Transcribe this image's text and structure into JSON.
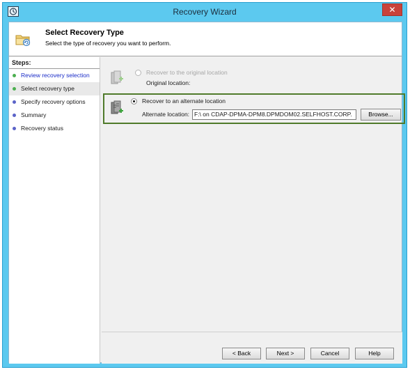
{
  "window": {
    "title": "Recovery Wizard",
    "close_label": "✕"
  },
  "header": {
    "title": "Select Recovery Type",
    "subtitle": "Select the type of recovery you want to perform."
  },
  "steps": {
    "heading": "Steps:",
    "items": [
      {
        "label": "Review recovery selection",
        "state": "done"
      },
      {
        "label": "Select recovery type",
        "state": "current"
      },
      {
        "label": "Specify recovery options",
        "state": "pending"
      },
      {
        "label": "Summary",
        "state": "pending"
      },
      {
        "label": "Recovery status",
        "state": "pending"
      }
    ]
  },
  "options": {
    "original": {
      "label": "Recover to the original location",
      "sublabel": "Original location:",
      "selected": false,
      "enabled": false
    },
    "alternate": {
      "label": "Recover to an alternate location",
      "sublabel": "Alternate location:",
      "value": "F:\\ on CDAP-DPMA-DPM8.DPMDOM02.SELFHOST.CORP.",
      "selected": true,
      "browse_label": "Browse..."
    }
  },
  "footer": {
    "back_label": "< Back",
    "next_label": "Next >",
    "cancel_label": "Cancel",
    "help_label": "Help"
  },
  "colors": {
    "titlebar": "#5cc9ef",
    "highlight_border": "#4f7a2a",
    "step_done": "#4caf50",
    "step_pending": "#5b63c8",
    "link": "#1a2cc8"
  }
}
